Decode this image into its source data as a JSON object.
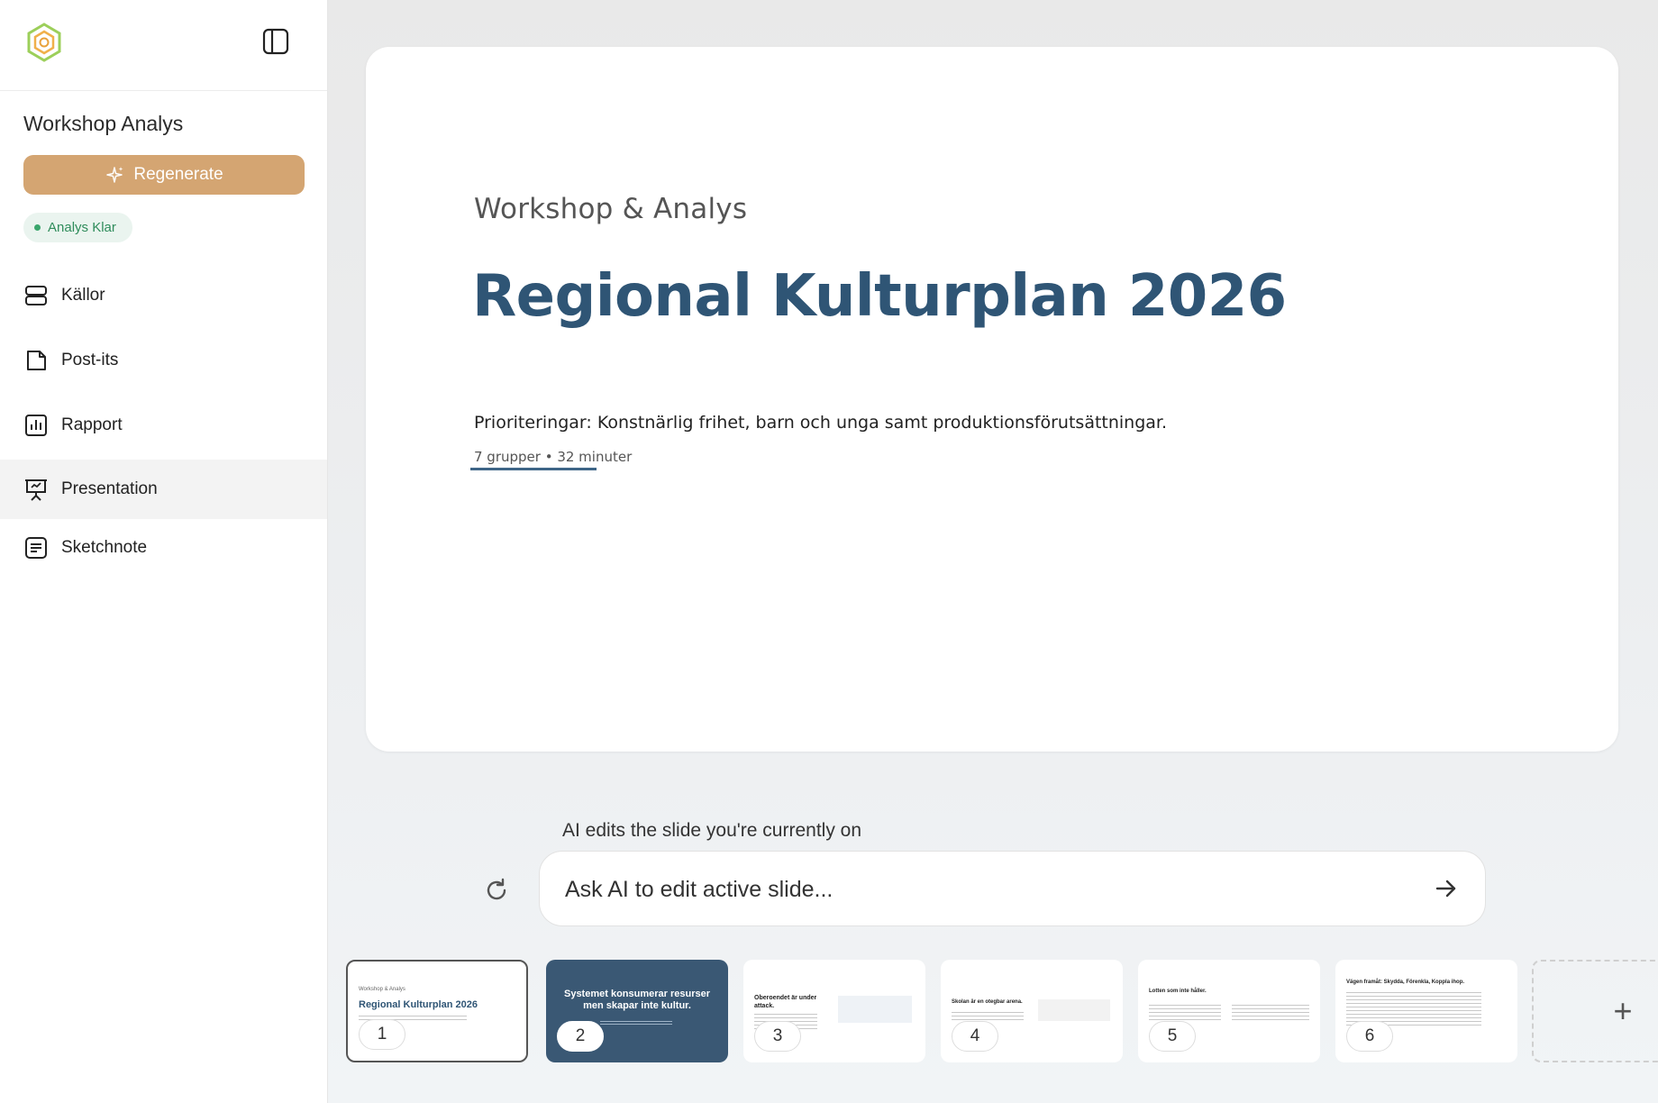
{
  "sidebar": {
    "project_title": "Workshop Analys",
    "regenerate_label": "Regenerate",
    "status": "Analys Klar",
    "items": [
      {
        "label": "Källor",
        "icon": "database-icon"
      },
      {
        "label": "Post-its",
        "icon": "note-icon"
      },
      {
        "label": "Rapport",
        "icon": "bar-chart-icon"
      },
      {
        "label": "Presentation",
        "icon": "presentation-icon",
        "active": true
      },
      {
        "label": "Sketchnote",
        "icon": "sketchnote-icon"
      }
    ]
  },
  "slide": {
    "eyebrow": "Workshop & Analys",
    "title": "Regional Kulturplan 2026",
    "subtitle": "Prioriteringar: Konstnärlig frihet, barn och unga samt produktionsförutsättningar.",
    "meta": "7 grupper • 32 minuter"
  },
  "ai": {
    "hint": "AI edits the slide you're currently on",
    "placeholder": "Ask AI to edit active slide..."
  },
  "thumbnails": [
    {
      "number": "1",
      "eyebrow": "Workshop & Analys",
      "title": "Regional Kulturplan 2026"
    },
    {
      "number": "2",
      "title": "Systemet konsumerar resurser men skapar inte kultur."
    },
    {
      "number": "3",
      "title": "Oberoendet är under attack."
    },
    {
      "number": "4",
      "title": "Skolan är en otegbar arena."
    },
    {
      "number": "5",
      "title": "Lotten som inte håller."
    },
    {
      "number": "6",
      "title": "Vägen framåt: Skydda, Förenkla, Koppla ihop."
    }
  ],
  "add_slide_label": "+",
  "colors": {
    "accent": "#d4a572",
    "slide_title": "#2f5575",
    "status_green": "#2f8c5b",
    "dark_slide": "#3a5874"
  }
}
